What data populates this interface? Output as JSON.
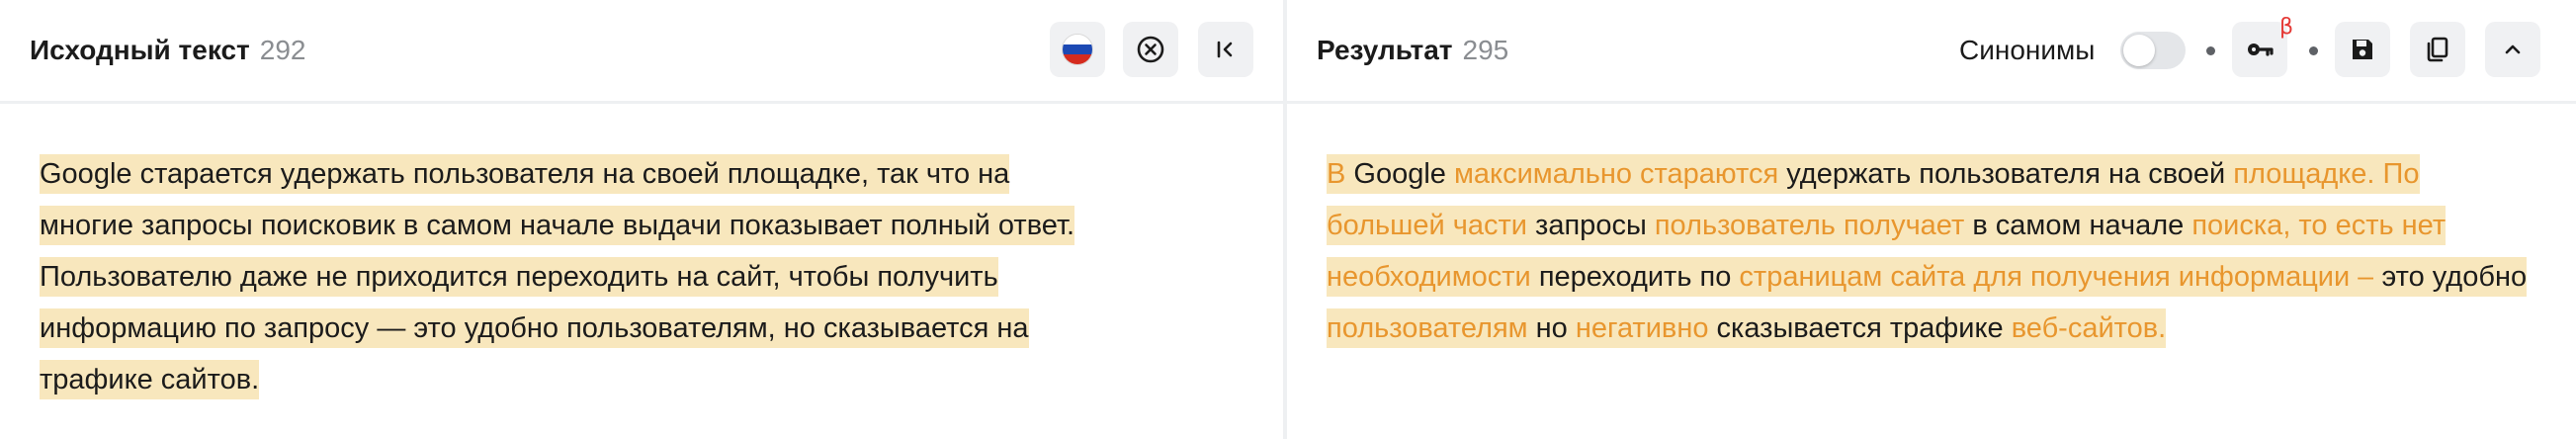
{
  "source": {
    "title": "Исходный текст",
    "count": "292",
    "language_flag": "russia-flag",
    "segments": [
      "Google старается удержать пользователя на своей площадке, так что на",
      " многие запросы поисковик в самом начале выдачи показывает полный ответ.",
      " Пользователю даже не приходится переходить на сайт, чтобы получить",
      " информацию по запросу — это удобно пользователям, но сказывается на",
      " трафике сайтов."
    ]
  },
  "result": {
    "title": "Результат",
    "count": "295",
    "synonyms_label": "Синонимы",
    "synonyms_enabled": false,
    "beta_badge": "β",
    "segments": [
      {
        "text": "В",
        "changed": true
      },
      {
        "text": " Google ",
        "changed": false
      },
      {
        "text": "максимально стараются",
        "changed": true
      },
      {
        "text": " удержать пользователя на своей ",
        "changed": false
      },
      {
        "text": "площадке.",
        "changed": true
      },
      {
        "text": " ",
        "changed": false
      },
      {
        "text": "По большей части",
        "changed": true
      },
      {
        "text": " запросы ",
        "changed": false
      },
      {
        "text": "пользователь получает",
        "changed": true
      },
      {
        "text": " в самом начале ",
        "changed": false
      },
      {
        "text": "поиска, то есть нет необходимости",
        "changed": true
      },
      {
        "text": " переходить по ",
        "changed": false
      },
      {
        "text": "страницам сайта для получения информации –",
        "changed": true
      },
      {
        "text": " это удобно ",
        "changed": false
      },
      {
        "text": "пользователям",
        "changed": true
      },
      {
        "text": " но ",
        "changed": false
      },
      {
        "text": "негативно",
        "changed": true
      },
      {
        "text": " сказывается  трафике ",
        "changed": false
      },
      {
        "text": "веб-сайтов.",
        "changed": true
      }
    ]
  },
  "colors": {
    "highlight": "#f8e7bd",
    "changed_text": "#e8962e",
    "beta": "#e53935"
  },
  "icons": {
    "clear": "close-circle-icon",
    "collapse": "collapse-left-icon",
    "key": "key-icon",
    "save": "save-icon",
    "copy": "copy-icon",
    "expand": "chevron-up-icon"
  }
}
